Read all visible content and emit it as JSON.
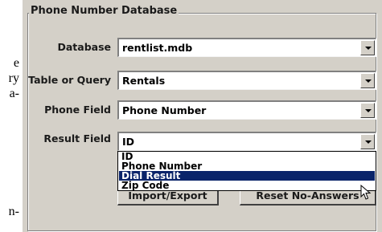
{
  "background_text": {
    "lines": [
      "e",
      "ry",
      "a-",
      "n-"
    ]
  },
  "group": {
    "title": "Phone Number Database"
  },
  "fields": {
    "database": {
      "label": "Database",
      "value": "rentlist.mdb"
    },
    "table_or_query": {
      "label": "Table or Query",
      "value": "Rentals"
    },
    "phone_field": {
      "label": "Phone Field",
      "value": "Phone Number"
    },
    "result_field": {
      "label": "Result Field",
      "value": "ID"
    }
  },
  "result_field_dropdown": {
    "options": [
      "ID",
      "Phone Number",
      "Dial Result",
      "Zip Code"
    ],
    "highlighted": "Dial Result"
  },
  "buttons": {
    "import_export": "Import/Export",
    "reset_no_answers": "Reset No-Answers"
  },
  "colors": {
    "dialog_bg": "#d4d0c8",
    "selection_bg": "#0a246a"
  },
  "icons": [
    "dropdown-arrow-icon",
    "mouse-pointer-icon"
  ]
}
